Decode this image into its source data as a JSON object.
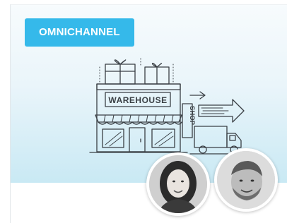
{
  "card": {
    "badge_label": "OMNICHANNEL",
    "illustration": {
      "warehouse_sign": "WAREHOUSE",
      "shop_sign": "SHOP",
      "icons": [
        "gift-box-icon",
        "arrow-right-icon",
        "delivery-truck-icon"
      ]
    },
    "avatars": [
      "avatar-woman",
      "avatar-man"
    ]
  },
  "colors": {
    "badge": "#35b9ea",
    "hero_gradient_top": "#f7fbfd",
    "hero_gradient_bottom": "#c9e9f4",
    "sketch_ink": "#3a3f44"
  }
}
